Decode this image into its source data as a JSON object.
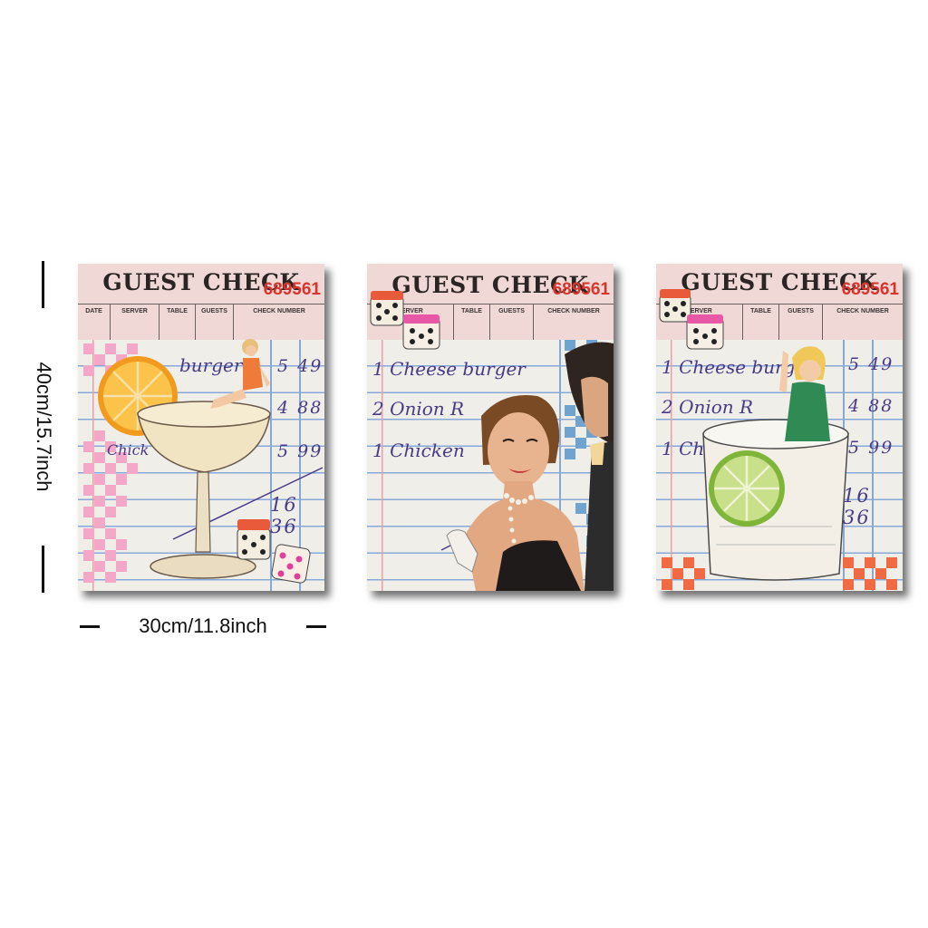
{
  "dimensions": {
    "height_label": "40cm/15.7inch",
    "width_label": "30cm/11.8inch"
  },
  "panels": [
    {
      "title": "GUEST CHECK",
      "columns": [
        "DATE",
        "SERVER",
        "TABLE",
        "GUESTS",
        "CHECK NUMBER"
      ],
      "check_number": "689561",
      "items": [
        "burger",
        "",
        "Chick"
      ],
      "prices": [
        "5 49",
        "4 88",
        "5 99"
      ],
      "total": "16 36",
      "accent_color": "#f4a8c8",
      "illustration": "cocktail-glass-pinup-orange-dice"
    },
    {
      "title": "GUEST CHECK",
      "columns": [
        "SERVER",
        "TABLE",
        "GUESTS",
        "CHECK NUMBER"
      ],
      "check_number": "689561",
      "items": [
        "1 Cheese burger",
        "2 Onion R",
        "1 Chicken"
      ],
      "prices": [],
      "total": "",
      "accent_color": "#6fa3d0",
      "illustration": "vintage-couple-dice"
    },
    {
      "title": "GUEST CHECK",
      "columns": [
        "SERVER",
        "TABLE",
        "GUESTS",
        "CHECK NUMBER"
      ],
      "check_number": "689561",
      "items": [
        "1 Cheese burg",
        "2 Onion R",
        "1 Ch"
      ],
      "prices": [
        "5 49",
        "4 88",
        "5 99"
      ],
      "total": "16 36",
      "accent_color": "#f06a44",
      "illustration": "lime-glass-pinup-dice"
    }
  ]
}
